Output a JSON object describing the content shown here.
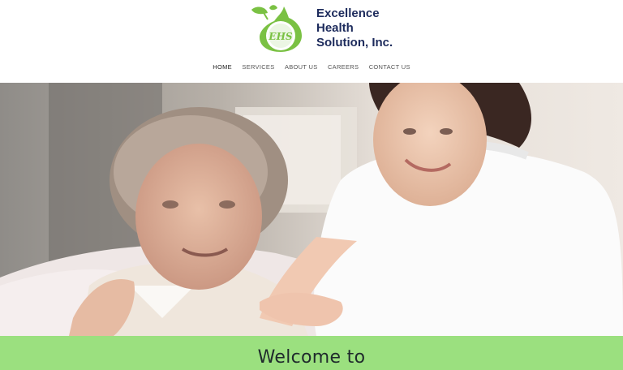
{
  "brand": {
    "monogram": "EHS",
    "name_lines": [
      "Excellence",
      "Health",
      "Solution, Inc."
    ]
  },
  "nav": {
    "items": [
      {
        "label": "HOME",
        "active": true
      },
      {
        "label": "SERVICES",
        "active": false
      },
      {
        "label": "ABOUT US",
        "active": false
      },
      {
        "label": "CAREERS",
        "active": false
      },
      {
        "label": "CONTACT US",
        "active": false
      }
    ]
  },
  "welcome": {
    "heading": "Welcome to"
  },
  "colors": {
    "brand_green": "#7ac143",
    "brand_navy": "#1d2b5c",
    "welcome_bg": "#9be07f"
  }
}
